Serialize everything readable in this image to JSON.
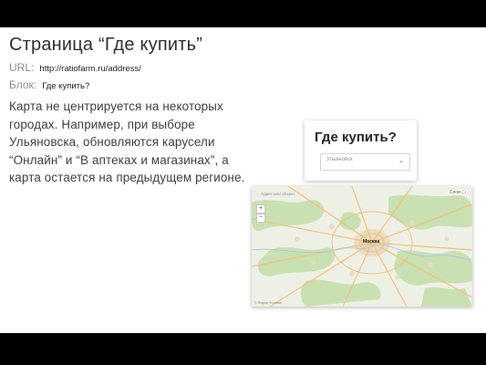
{
  "slide": {
    "title": "Страница “Где купить”",
    "url_label": "URL:",
    "url_value": "http://ratiofarm.ru/address/",
    "block_label": "Блок:",
    "block_value": "Где купить?",
    "description": "Карта не центрируется на некоторых городах. Например, при выборе Ульяновска, обновляются карусели “Онлайн” и “В аптеках и магазинах”, а карта остается на предыдущем регионе."
  },
  "widget": {
    "heading": "Где купить?",
    "select_value": "Ульяновск",
    "chevron_icon": "chevron-down-icon"
  },
  "map": {
    "search_placeholder": "Адрес или объект",
    "top_controls": "Слои  ▢",
    "zoom_in": "+",
    "zoom_out": "−",
    "capital_label": "Москва",
    "attribution": "© Яндекс  Условия",
    "colors": {
      "land": "#eef0e6",
      "forest": "#c6dfae",
      "roads": "#f3c07a",
      "city_fill": "#e8dcc4"
    }
  }
}
